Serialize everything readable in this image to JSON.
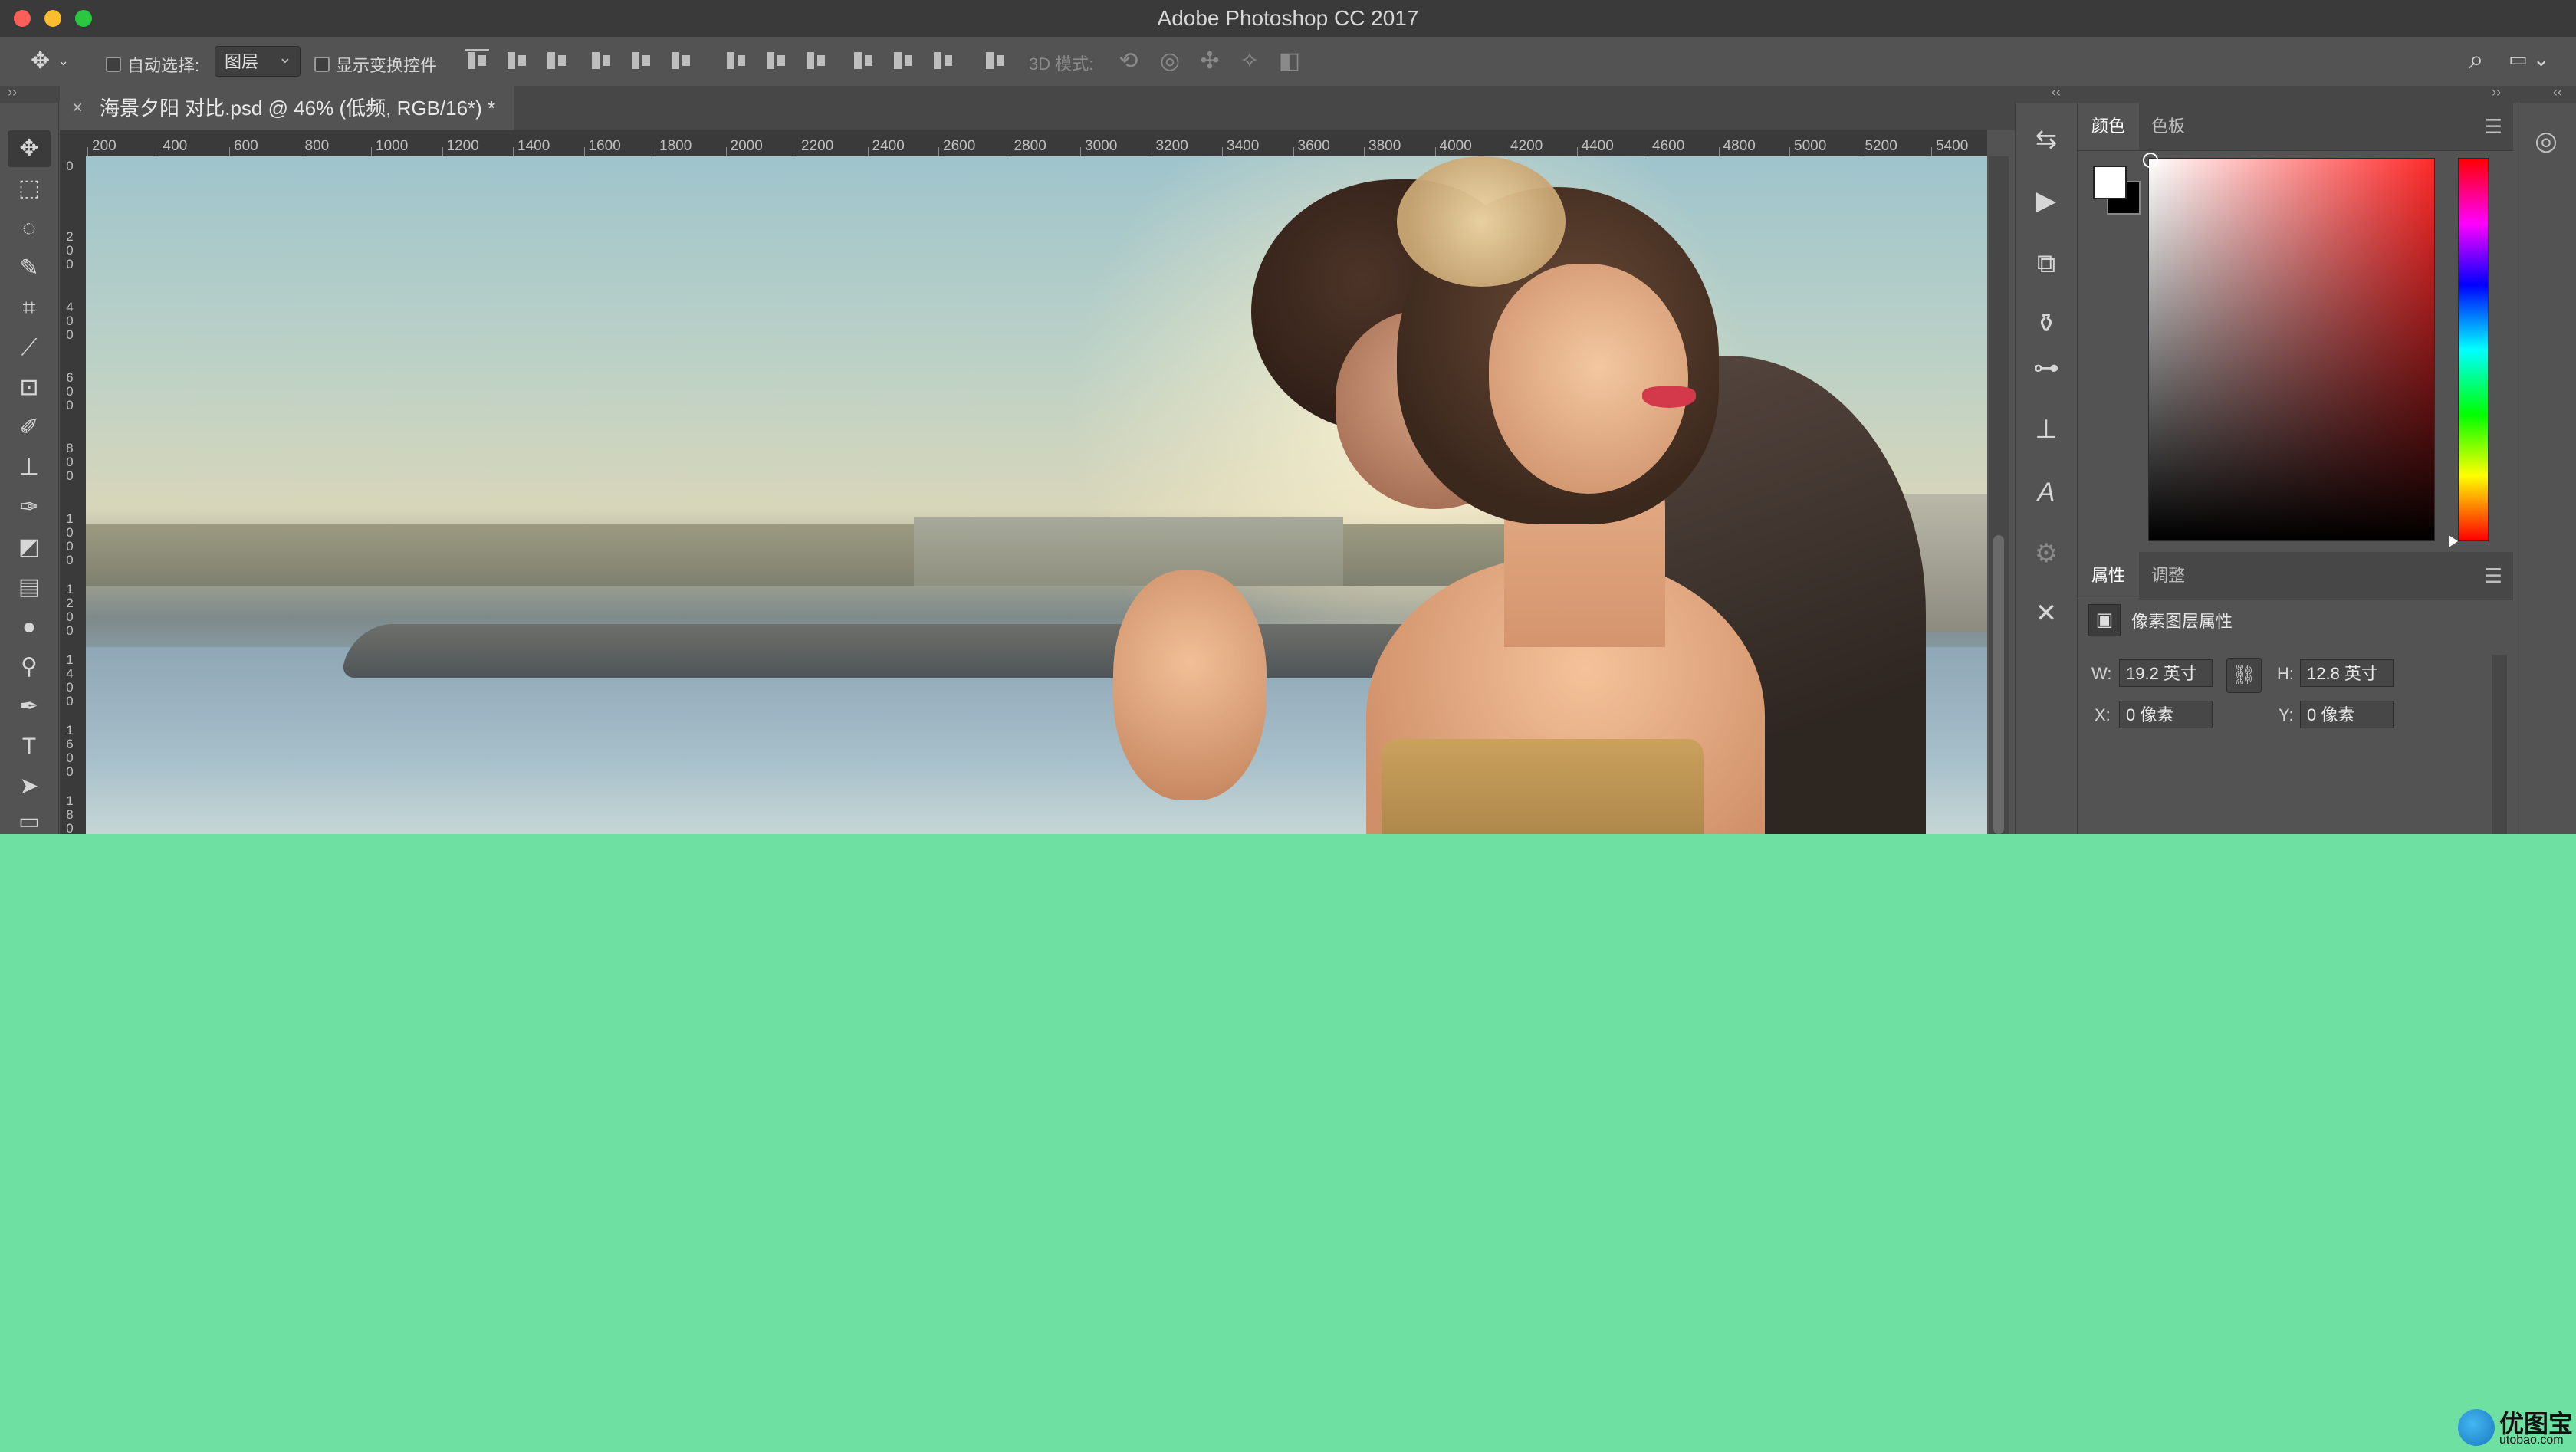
{
  "window": {
    "title": "Adobe Photoshop CC 2017"
  },
  "options_bar": {
    "auto_select_label": "自动选择:",
    "auto_select_value": "图层",
    "show_transform_label": "显示变换控件",
    "mode_3d_label": "3D 模式:"
  },
  "document": {
    "tab_title": "海景夕阳 对比.psd @ 46% (低频, RGB/16*) *",
    "close_glyph": "×"
  },
  "ruler": {
    "top_ticks": [
      "200",
      "400",
      "600",
      "800",
      "1000",
      "1200",
      "1400",
      "1600",
      "1800",
      "2000",
      "2200",
      "2400",
      "2600",
      "2800",
      "3000",
      "3200",
      "3400",
      "3600",
      "3800",
      "4000",
      "4200",
      "4400",
      "4600",
      "4800",
      "5000",
      "5200",
      "5400"
    ],
    "left_ticks": [
      "0",
      "2 0 0",
      "4 0 0",
      "6 0 0",
      "8 0 0",
      "1 0 0 0",
      "1 2 0 0",
      "1 4 0 0",
      "1 6 0 0",
      "1 8 0 0"
    ]
  },
  "color_panel": {
    "tab_color": "颜色",
    "tab_swatches": "色板",
    "foreground": "#ffffff",
    "background": "#000000",
    "hue_color": "#ff2a2a"
  },
  "properties_panel": {
    "tab_properties": "属性",
    "tab_adjustments": "调整",
    "header": "像素图层属性",
    "w_label": "W:",
    "w_value": "19.2 英寸",
    "h_label": "H:",
    "h_value": "12.8 英寸",
    "x_label": "X:",
    "x_value": "0 像素",
    "y_label": "Y:",
    "y_value": "0 像素"
  },
  "watermark": {
    "name": "优图宝",
    "url": "utobao.com"
  },
  "tools": [
    "move-tool",
    "marquee-tool",
    "lasso-tool",
    "quick-select-tool",
    "crop-tool",
    "eyedropper-tool",
    "frame-tool",
    "brush-tool",
    "stamp-tool",
    "history-brush-tool",
    "eraser-tool",
    "gradient-tool",
    "blur-tool",
    "dodge-tool",
    "pen-tool",
    "type-tool",
    "path-select-tool",
    "shape-tool"
  ],
  "icons": {
    "menu": "☰",
    "search": "⌕",
    "link": "⛓"
  }
}
